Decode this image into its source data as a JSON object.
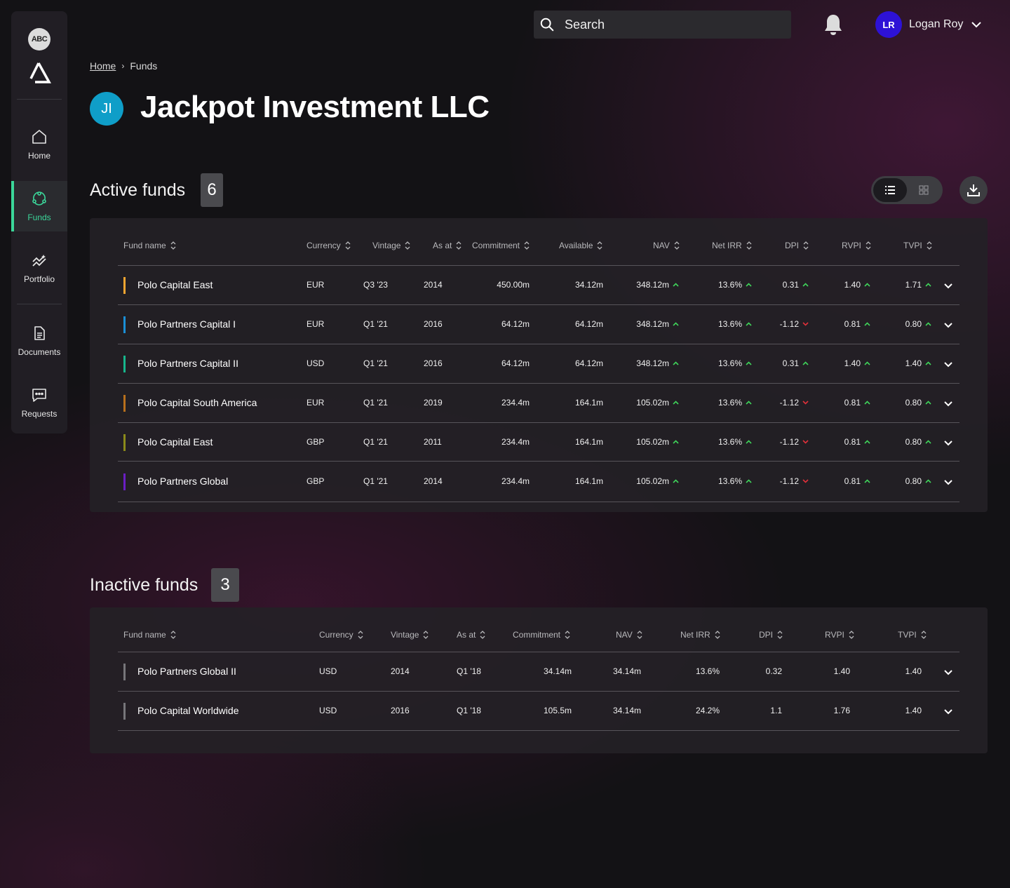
{
  "sidebar": {
    "logo_text": "ABC",
    "items": [
      {
        "label": "Home",
        "icon": "home-icon"
      },
      {
        "label": "Funds",
        "icon": "funds-icon",
        "active": true
      },
      {
        "label": "Portfolio",
        "icon": "portfolio-icon"
      },
      {
        "label": "Documents",
        "icon": "document-icon"
      },
      {
        "label": "Requests",
        "icon": "chat-icon"
      }
    ],
    "accent": "#3bd79a"
  },
  "header": {
    "search_placeholder": "Search",
    "user_initials": "LR",
    "user_name": "Logan Roy"
  },
  "breadcrumb": {
    "home": "Home",
    "current": "Funds"
  },
  "page": {
    "avatar_initials": "JI",
    "title": "Jackpot Investment LLC"
  },
  "active": {
    "title": "Active funds",
    "count": "6",
    "headers": [
      "Fund name",
      "Currency",
      "Vintage",
      "As at",
      "Commitment",
      "Available",
      "NAV",
      "Net IRR",
      "DPI",
      "RVPI",
      "TVPI"
    ],
    "rows": [
      {
        "color": "#f2a531",
        "name": "Polo Capital East",
        "currency": "EUR",
        "vintage": "Q3 '23",
        "as_at": "2014",
        "commitment": "450.00m",
        "available": "34.12m",
        "nav": "348.12m",
        "nav_trend": "up",
        "irr": "13.6%",
        "irr_trend": "up",
        "dpi": "0.31",
        "dpi_trend": "up",
        "rvpi": "1.40",
        "rvpi_trend": "up",
        "tvpi": "1.71",
        "tvpi_trend": "up"
      },
      {
        "color": "#1a8fd6",
        "name": "Polo Partners Capital I",
        "currency": "EUR",
        "vintage": "Q1 '21",
        "as_at": "2016",
        "commitment": "64.12m",
        "available": "64.12m",
        "nav": "348.12m",
        "nav_trend": "up",
        "irr": "13.6%",
        "irr_trend": "up",
        "dpi": "-1.12",
        "dpi_trend": "down",
        "rvpi": "0.81",
        "rvpi_trend": "up",
        "tvpi": "0.80",
        "tvpi_trend": "up"
      },
      {
        "color": "#17b68c",
        "name": "Polo Partners Capital II",
        "currency": "USD",
        "vintage": "Q1 '21",
        "as_at": "2016",
        "commitment": "64.12m",
        "available": "64.12m",
        "nav": "348.12m",
        "nav_trend": "up",
        "irr": "13.6%",
        "irr_trend": "up",
        "dpi": "0.31",
        "dpi_trend": "up",
        "rvpi": "1.40",
        "rvpi_trend": "up",
        "tvpi": "1.40",
        "tvpi_trend": "up"
      },
      {
        "color": "#b8701c",
        "name": "Polo Capital South America",
        "currency": "EUR",
        "vintage": "Q1 '21",
        "as_at": "2019",
        "commitment": "234.4m",
        "available": "164.1m",
        "nav": "105.02m",
        "nav_trend": "up",
        "irr": "13.6%",
        "irr_trend": "up",
        "dpi": "-1.12",
        "dpi_trend": "down",
        "rvpi": "0.81",
        "rvpi_trend": "up",
        "tvpi": "0.80",
        "tvpi_trend": "up"
      },
      {
        "color": "#8b8a1a",
        "name": "Polo Capital East",
        "currency": "GBP",
        "vintage": "Q1 '21",
        "as_at": "2011",
        "commitment": "234.4m",
        "available": "164.1m",
        "nav": "105.02m",
        "nav_trend": "up",
        "irr": "13.6%",
        "irr_trend": "up",
        "dpi": "-1.12",
        "dpi_trend": "down",
        "rvpi": "0.81",
        "rvpi_trend": "up",
        "tvpi": "0.80",
        "tvpi_trend": "up"
      },
      {
        "color": "#6a1ec4",
        "name": "Polo Partners Global",
        "currency": "GBP",
        "vintage": "Q1 '21",
        "as_at": "2014",
        "commitment": "234.4m",
        "available": "164.1m",
        "nav": "105.02m",
        "nav_trend": "up",
        "irr": "13.6%",
        "irr_trend": "up",
        "dpi": "-1.12",
        "dpi_trend": "down",
        "rvpi": "0.81",
        "rvpi_trend": "up",
        "tvpi": "0.80",
        "tvpi_trend": "up"
      }
    ]
  },
  "inactive": {
    "title": "Inactive funds",
    "count": "3",
    "headers": [
      "Fund name",
      "Currency",
      "Vintage",
      "As at",
      "Commitment",
      "NAV",
      "Net IRR",
      "DPI",
      "RVPI",
      "TVPI"
    ],
    "rows": [
      {
        "color": "#77767a",
        "name": "Polo Partners Global II",
        "currency": "USD",
        "vintage": "2014",
        "as_at": "Q1 '18",
        "commitment": "34.14m",
        "nav": "34.14m",
        "irr": "13.6%",
        "dpi": "0.32",
        "rvpi": "1.40",
        "tvpi": "1.40"
      },
      {
        "color": "#77767a",
        "name": "Polo Capital Worldwide",
        "currency": "USD",
        "vintage": "2016",
        "as_at": "Q1 '18",
        "commitment": "105.5m",
        "nav": "34.14m",
        "irr": "24.2%",
        "dpi": "1.1",
        "rvpi": "1.76",
        "tvpi": "1.40"
      }
    ]
  },
  "colors": {
    "trend_up": "#3fd35a",
    "trend_down": "#e0303a"
  }
}
